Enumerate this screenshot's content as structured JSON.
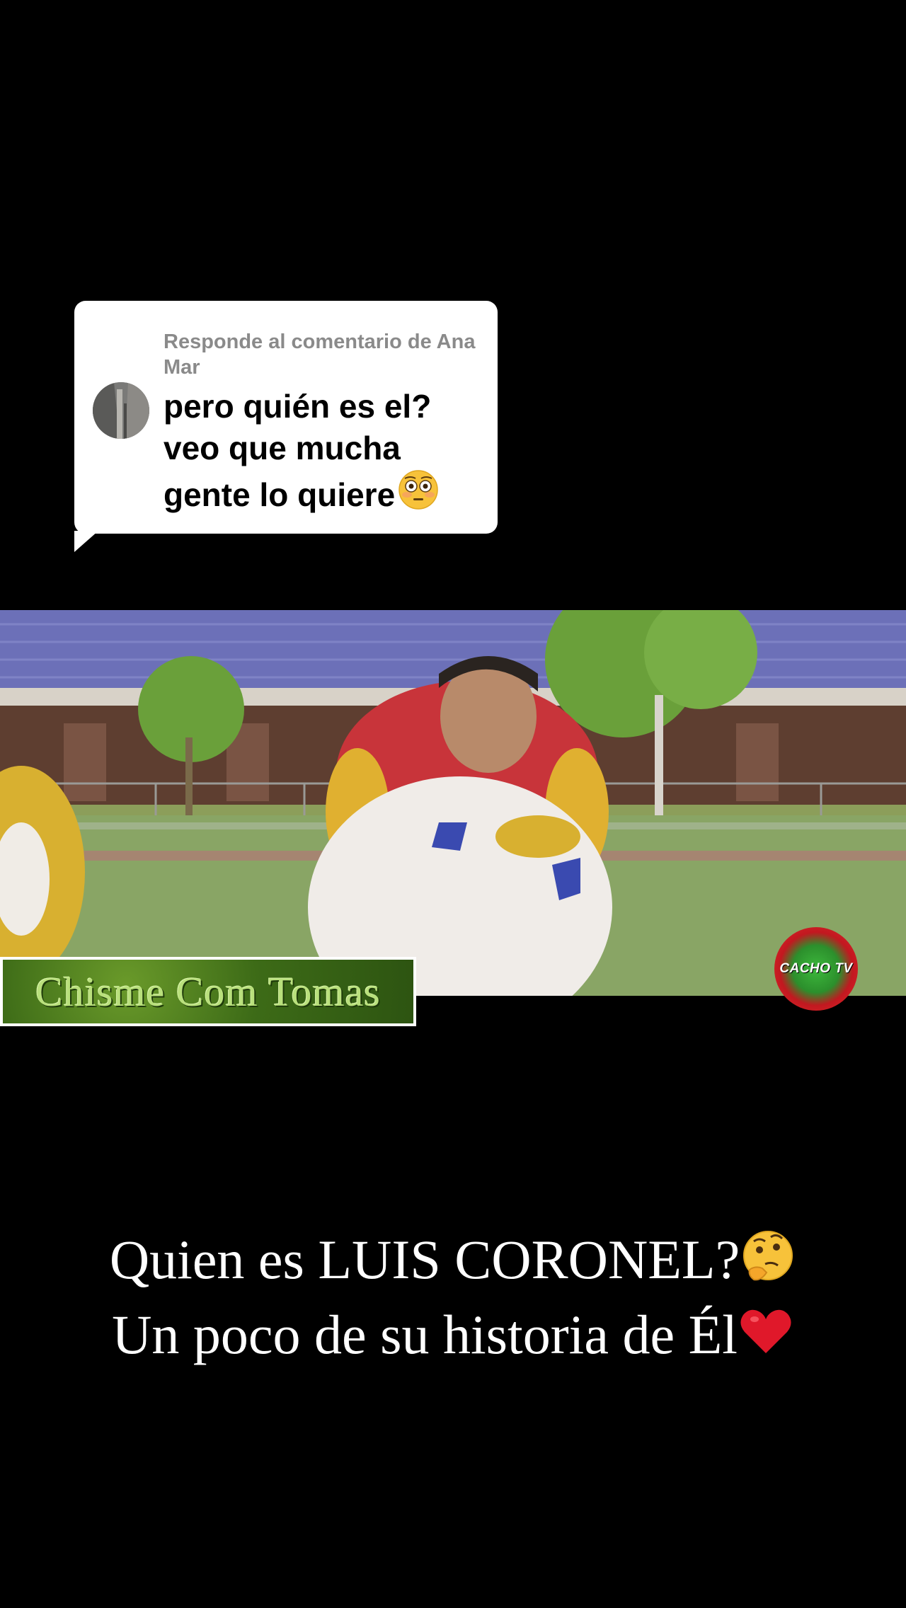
{
  "reply": {
    "header": "Responde al comentario de Ana Mar",
    "text": "pero quién es el? veo que mucha gente lo quiere",
    "emoji": "flushed-face-icon"
  },
  "video": {
    "watermark_left": "Chisme Com Tomas",
    "watermark_right": "CACHO TV"
  },
  "caption": {
    "line1": "Quien es LUIS CORONEL?",
    "line1_emoji": "thinking-face-icon",
    "line2": "Un poco de su  historia de Él",
    "line2_emoji": "red-heart-icon"
  }
}
